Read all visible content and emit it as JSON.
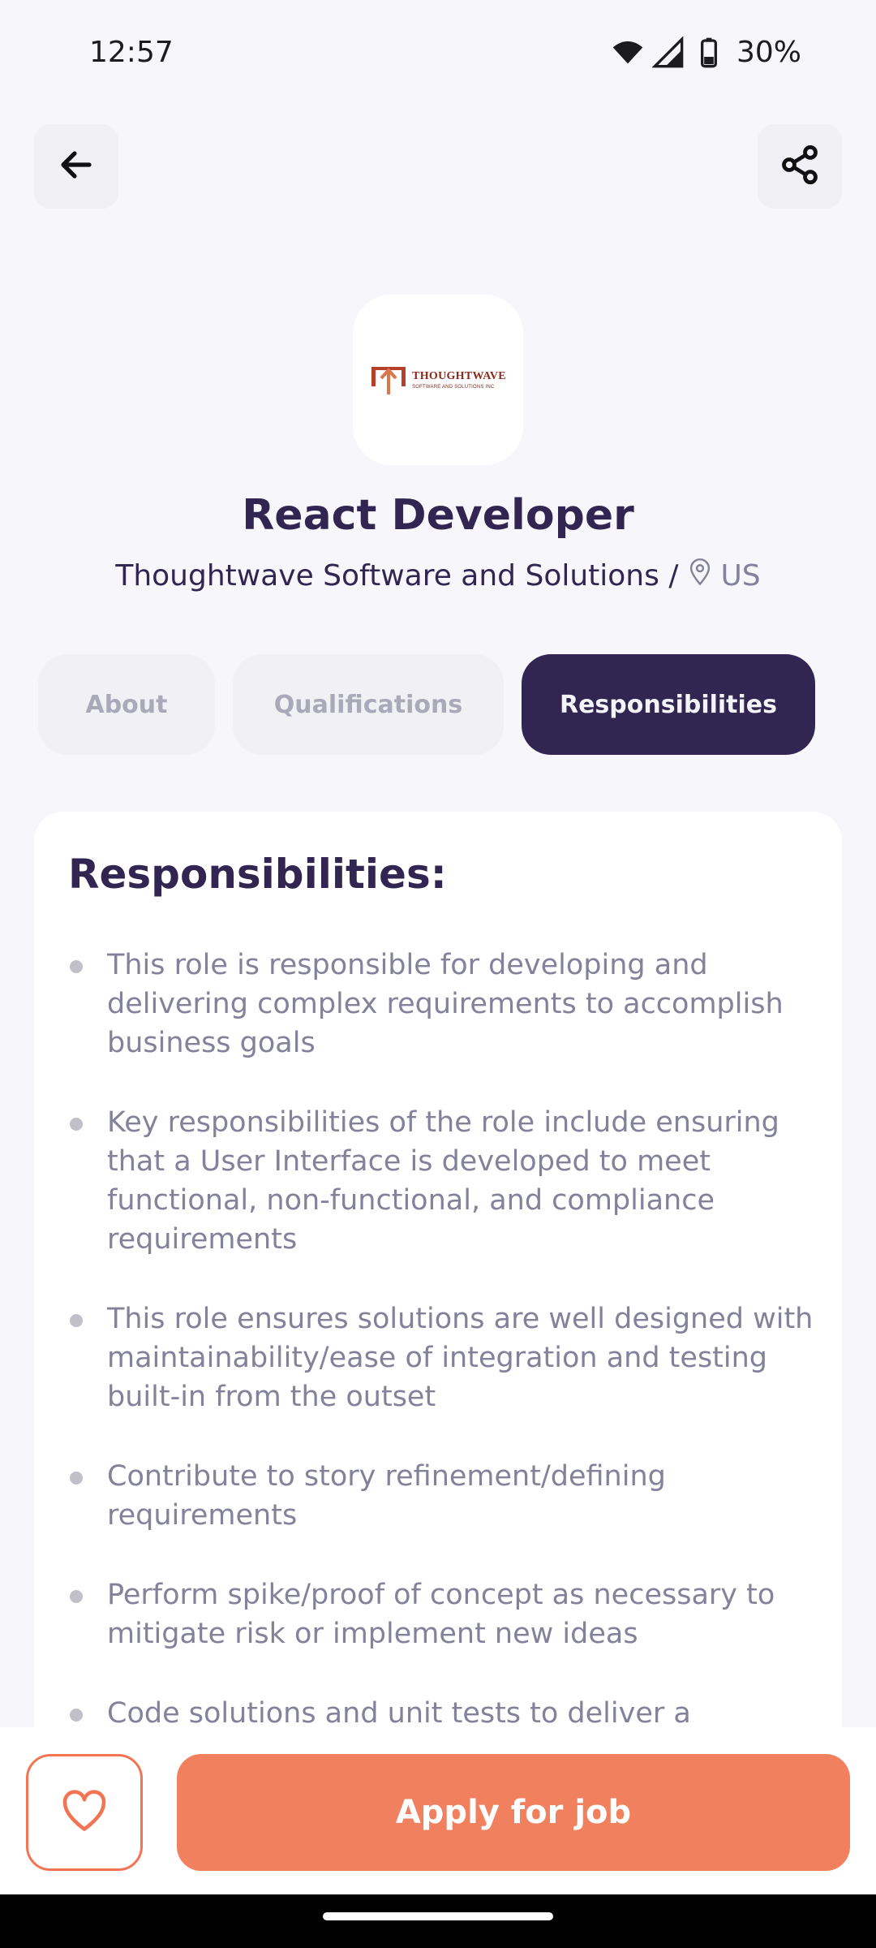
{
  "status_bar": {
    "time": "12:57",
    "battery": "30%",
    "icons": [
      "wifi-icon",
      "signal-icon",
      "battery-icon"
    ]
  },
  "header": {
    "back_icon": "arrow-left-icon",
    "share_icon": "share-icon"
  },
  "company": {
    "logo_name": "THOUGHTWAVE",
    "logo_sub": "SOFTWARE AND SOLUTIONS INC",
    "name": "Thoughtwave Software and Solutions /",
    "location": "US",
    "location_icon": "location-pin-icon"
  },
  "job": {
    "title": "React Developer"
  },
  "tabs": [
    {
      "label": "About",
      "active": false
    },
    {
      "label": "Qualifications",
      "active": false
    },
    {
      "label": "Responsibilities",
      "active": true
    }
  ],
  "content": {
    "title": "Responsibilities:",
    "items": [
      "This role is responsible for developing and delivering complex requirements to accomplish business goals",
      "Key responsibilities of the role include ensuring that a User Interface is developed to meet functional, non-functional, and compliance requirements",
      "This role ensures solutions are well designed with maintainability/ease of integration and testing built-in from the outset",
      "Contribute to story refinement/defining requirements",
      "Perform spike/proof of concept as necessary to mitigate risk or implement new ideas",
      "Code solutions and unit tests to deliver a"
    ]
  },
  "footer": {
    "favorite_icon": "heart-icon",
    "apply_label": "Apply for job"
  },
  "colors": {
    "primary": "#312651",
    "accent": "#F0805E",
    "gray": "#83829A",
    "background": "#F7F7FB"
  }
}
